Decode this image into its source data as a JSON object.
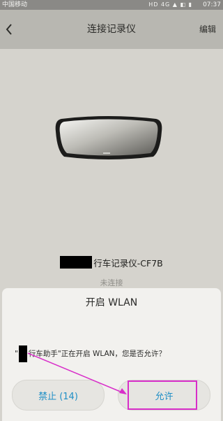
{
  "status_bar": {
    "carrier": "中国移动",
    "icons": "HD 4G ▲ ◧ ▮",
    "time": "07:37"
  },
  "header": {
    "title": "连接记录仪",
    "edit_label": "编辑",
    "back_icon": "chevron-left-icon"
  },
  "device": {
    "name": "行车记录仪-CF7B",
    "status": "未连接"
  },
  "dialog": {
    "title": "开启 WLAN",
    "message_prefix": "\"",
    "message_app": "行车助手\"",
    "message_body": "正在开启 WLAN，您是否允许？",
    "deny_label": "禁止 (14)",
    "allow_label": "允许"
  },
  "colors": {
    "accent": "#1f8fc6",
    "annotation": "#d82ec9"
  }
}
